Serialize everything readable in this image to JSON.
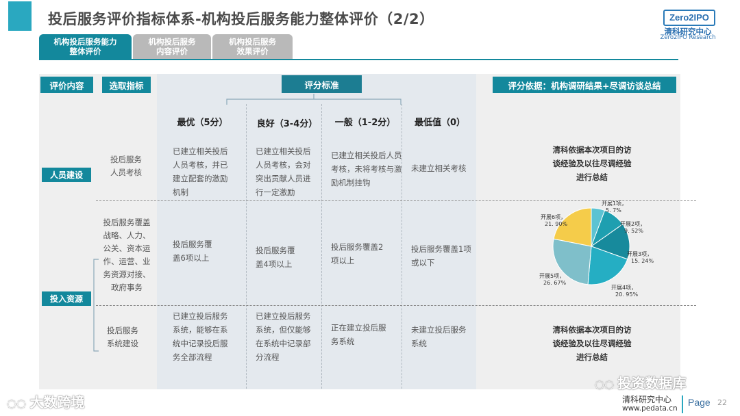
{
  "title": "投后服务评价指标体系-机构投后服务能力整体评价（2/2）",
  "logo": {
    "mark": "Zero2IPO",
    "cn": "清科研究中心",
    "en": "Zero2IPO Research"
  },
  "tabs": [
    {
      "label": "机构投后服务能力\n整体评价"
    },
    {
      "label": "机构投后服务\n内容评价"
    },
    {
      "label": "机构投后服务\n效果评价"
    }
  ],
  "headers": {
    "content": "评价内容",
    "indicator": "选取指标",
    "score": "评分标准",
    "basis": "评分依据：机构调研结果+尽调访谈总结"
  },
  "levels": [
    "最优（5分）",
    "良好（3-4分）",
    "一般（1-2分）",
    "最低值（0）"
  ],
  "categories": [
    "人员建设",
    "投入资源"
  ],
  "rows": [
    {
      "indicator": "投后服务\n人员考核",
      "cells": [
        "已建立相关投后\n人员考核，并已\n建立配套的激励\n机制",
        "已建立相关投后\n人员考核，会对\n突出贡献人员进\n行一定激励",
        "已建立相关投后人员\n考核，未将考核与激\n励机制挂钩",
        "未建立相关考核"
      ]
    },
    {
      "indicator": "投后服务覆盖\n战略、人力、\n公关、资本运\n作、运营、业\n务资源对接、\n政府事务",
      "cells": [
        "投后服务覆\n盖6项以上",
        "投后服务覆\n盖4项以上",
        "投后服务覆盖2\n项以上",
        "投后服务覆盖1项\n或以下"
      ]
    },
    {
      "indicator": "投后服务\n系统建设",
      "cells": [
        "已建立投后服务\n系统，能够在系\n统中记录投后服\n务全部流程",
        "已建立投后服务\n系统，但仅能够\n在系统中记录部\n分流程",
        "正在建立投后服\n务系统",
        "未建立投后服务\n系统"
      ]
    }
  ],
  "basis_texts": [
    "清科依据本次项目的访\n谈经验及以往尽调经验\n进行总结",
    "清科依据本次项目的访\n谈经验及以往尽调经验\n进行总结"
  ],
  "chart_data": {
    "type": "pie",
    "categories": [
      "开展1项",
      "开展2项",
      "开展3项",
      "开展4项",
      "开展5项",
      "开展6项"
    ],
    "values": [
      5.7,
      9.52,
      15.24,
      20.95,
      26.67,
      21.9
    ],
    "value_labels": [
      "5. 7%",
      "9. 52%",
      "15. 24%",
      "20. 95%",
      "26. 67%",
      "21. 90%"
    ],
    "colors": [
      "#5cc3d3",
      "#1e9fb0",
      "#178a9c",
      "#25aec3",
      "#7fbfca",
      "#f5cc4a"
    ]
  },
  "watermark": {
    "left": "大数跨境",
    "right": "投资数据库"
  },
  "footer": {
    "org": "清科研究中心",
    "url": "www.pedata.cn",
    "page_label": "Page",
    "page_num": "22"
  }
}
